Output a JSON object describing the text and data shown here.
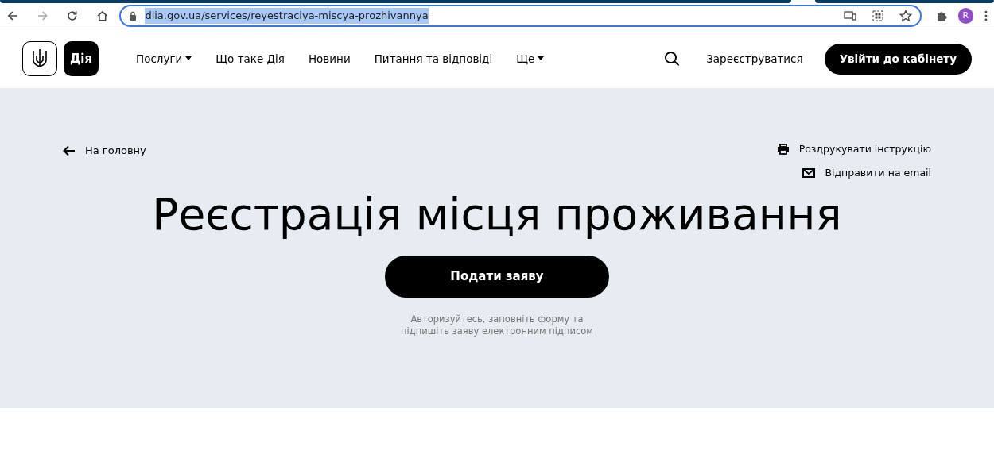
{
  "browser": {
    "url": "diia.gov.ua/services/reyestraciya-miscya-prozhivannya",
    "profile_initial": "R"
  },
  "header": {
    "logo_text": "Дія",
    "nav": [
      {
        "label": "Послуги",
        "kind": "dropdown"
      },
      {
        "label": "Що таке Дія",
        "kind": "link"
      },
      {
        "label": "Новини",
        "kind": "link"
      },
      {
        "label": "Питання та відповіді",
        "kind": "link"
      },
      {
        "label": "Ще",
        "kind": "dropdown"
      }
    ],
    "register": "Зареєструватися",
    "login": "Увійти до кабінету"
  },
  "hero": {
    "back": "На головну",
    "actions": [
      {
        "label": "Роздрукувати інструкцію",
        "kind": "print"
      },
      {
        "label": "Відправити на email",
        "kind": "email"
      }
    ],
    "title": "Реєстрація місця проживання",
    "button": "Подати заяву",
    "hint_lines": [
      "Авторизуйтесь, заповніть форму та",
      "підпишіть заяву електронним підписом"
    ]
  }
}
